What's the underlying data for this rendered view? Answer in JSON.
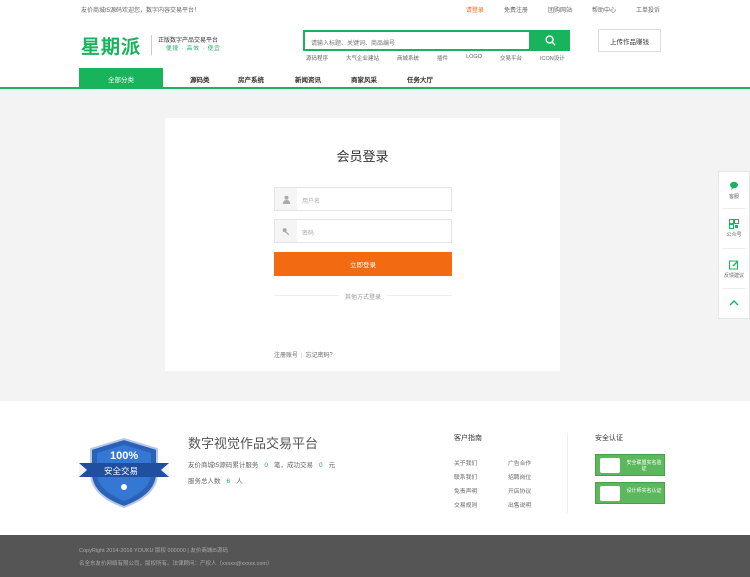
{
  "topbar": {
    "welcome": "友价商城t5源码欢迎您，数字内容交易平台！",
    "links": [
      "请登录",
      "免费注册",
      "团购网站",
      "帮助中心",
      "工单投诉"
    ]
  },
  "header": {
    "logo": "星期派",
    "slogan": "正版数字产品交易平台",
    "slogan_tags": "便捷 · 高效 · 便宜",
    "search_placeholder": "请输入标题、关键词、商品编号",
    "hotwords": [
      "源码程序",
      "大气企业建站",
      "商城系统",
      "插件",
      "LOGO",
      "交易平台",
      "ICON设计"
    ],
    "upload_label": "上传作品赚钱"
  },
  "nav": {
    "all_label": "全部分类",
    "items": [
      "源码类",
      "房产系统",
      "新闻资讯",
      "商家风采",
      "任务大厅"
    ]
  },
  "login": {
    "title": "会员登录",
    "username_placeholder": "用户名",
    "password_placeholder": "密码",
    "submit_label": "立即登录",
    "other_label": "其他方式登录",
    "register_label": "注册账号",
    "forgot_label": "忘记密码？"
  },
  "float": {
    "items": [
      "客服",
      "公众号",
      "反馈建议"
    ]
  },
  "footer": {
    "badge_percent": "100%",
    "badge_text": "安全交易",
    "title": "数字视觉作品交易平台",
    "line1_pre": "友价商城t5源码累计服务",
    "line1_n1": "0",
    "line1_mid": "笔，成功交易",
    "line1_n2": "0",
    "line1_post": "元",
    "line2_pre": "服务总人数",
    "line2_n": "6",
    "line2_post": "人",
    "guide_title": "客户指南",
    "guide_col1": [
      "关于我们",
      "联系我们",
      "免责声明",
      "交易规则"
    ],
    "guide_col2": [
      "广告合作",
      "招聘岗位",
      "开店协议",
      "出售说明"
    ],
    "cert_title": "安全认证",
    "cert1": "安全联盟实名验证",
    "cert2": "设计师实名认证"
  },
  "bottom": {
    "copyright": "CopyRight 2014-2016 YOUKU 版权 000000 | 友价商城t5源码",
    "contact": "名全东友价网络有限公司，版权所有。法律顾问：产权人（xxxxx@xxxxx.com）"
  },
  "colors": {
    "brand_green": "#19b35c",
    "accent_orange": "#f26a11"
  }
}
